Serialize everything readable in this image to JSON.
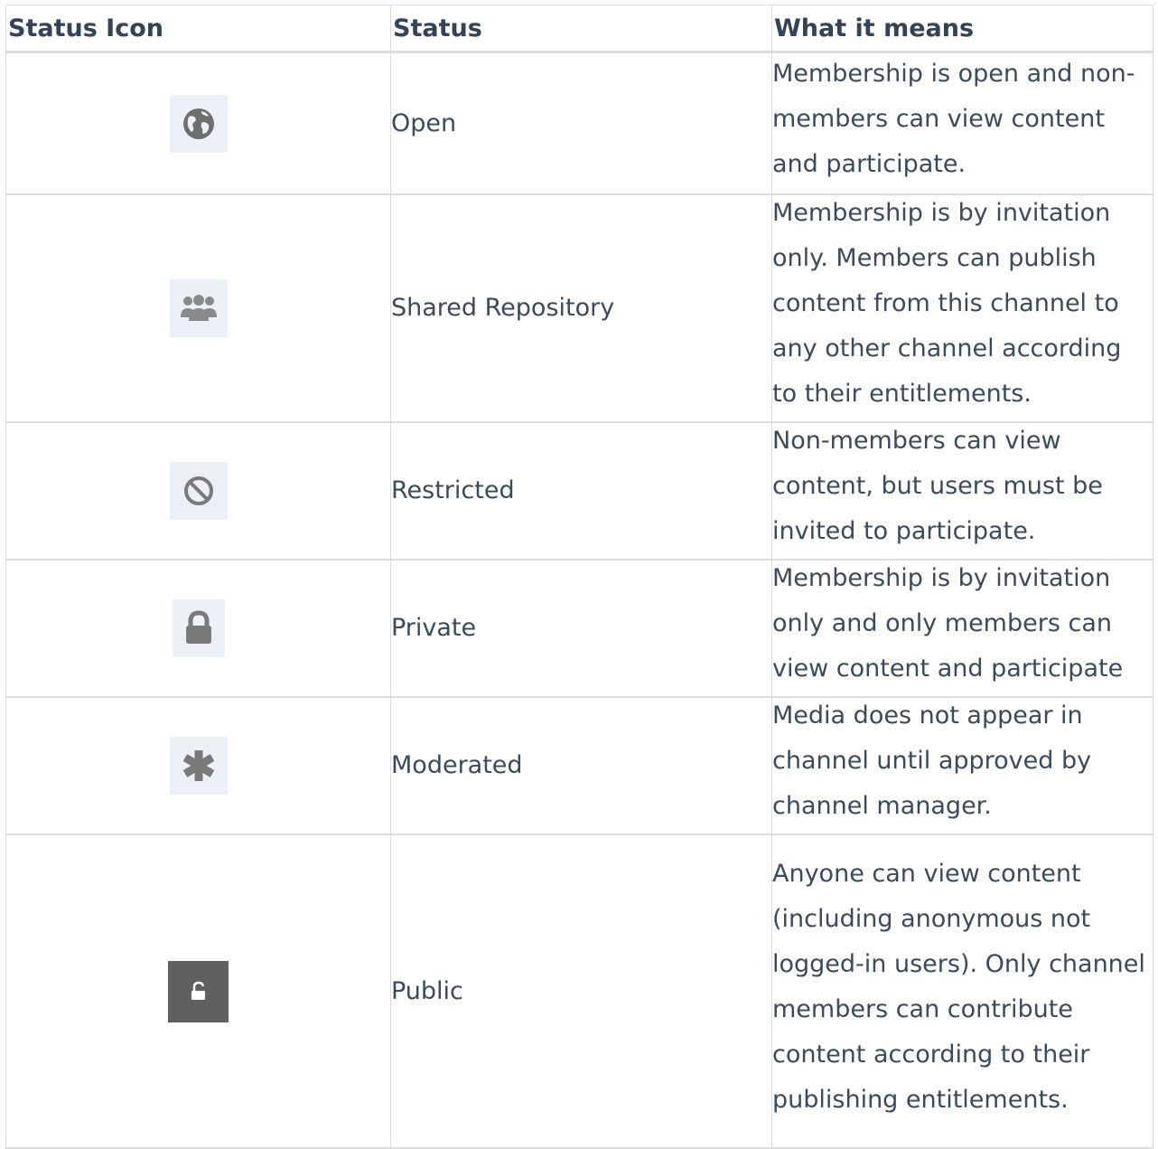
{
  "table": {
    "headers": [
      "Status Icon",
      "Status",
      "What it means"
    ],
    "rows": [
      {
        "icon": "globe-icon",
        "status": "Open",
        "meaning": "Membership is open and non-members can view content and participate."
      },
      {
        "icon": "users-icon",
        "status": "Shared Repository",
        "meaning": "Membership is by invitation only. Members can publish content from this channel to any other channel according to their entitlements."
      },
      {
        "icon": "ban-icon",
        "status": "Restricted",
        "meaning": "Non-members can view content, but users must be invited to participate."
      },
      {
        "icon": "lock-icon",
        "status": "Private",
        "meaning": "Membership is by invitation only and only members can view content and participate"
      },
      {
        "icon": "asterisk-icon",
        "status": "Moderated",
        "meaning": "Media does not appear in channel until approved by channel manager."
      },
      {
        "icon": "unlock-icon",
        "status": "Public",
        "meaning": "Anyone can view content (including anonymous not logged-in users). Only channel members can contribute content according to their publishing entitlements."
      }
    ]
  },
  "colors": {
    "text": "#3b4a5c",
    "header_text": "#344357",
    "border": "#dcdcdc",
    "icon_bg": "#ecf1f7",
    "icon_fg": "#7a7a7a",
    "public_icon_bg": "#606060"
  }
}
